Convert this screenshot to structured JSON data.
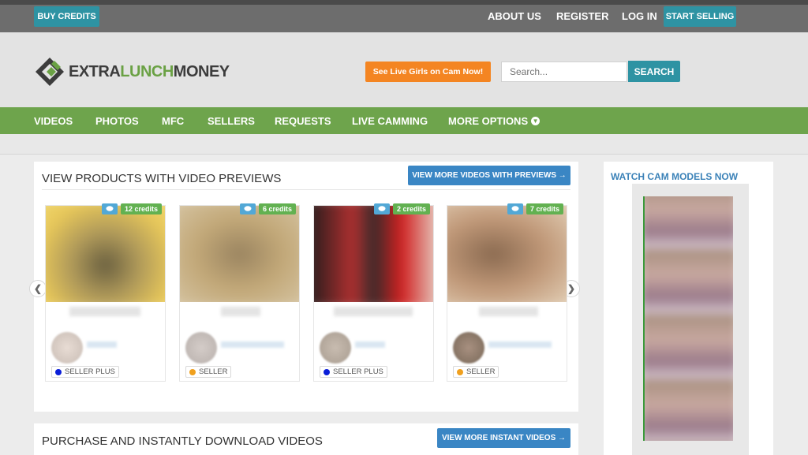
{
  "topbar": {
    "buy_credits": "BUY CREDITS",
    "links": [
      "ABOUT US",
      "REGISTER",
      "LOG IN"
    ],
    "start_selling": "START SELLING"
  },
  "header": {
    "logo_part1": "EXTRA",
    "logo_part2": "LUNCH",
    "logo_part3": "MONEY",
    "live_button": "See Live Girls on Cam Now!",
    "search_placeholder": "Search...",
    "search_button": "SEARCH"
  },
  "nav": {
    "items": [
      "VIDEOS",
      "PHOTOS",
      "MFC",
      "SELLERS",
      "REQUESTS",
      "LIVE CAMMING",
      "MORE OPTIONS"
    ]
  },
  "section1": {
    "title": "VIEW PRODUCTS WITH VIDEO PREVIEWS",
    "button": "VIEW MORE VIDEOS WITH PREVIEWS →",
    "products": [
      {
        "credits": "12 credits",
        "tier": "SELLER PLUS",
        "tier_color": "#0a1ed8"
      },
      {
        "credits": "6 credits",
        "tier": "SELLER",
        "tier_color": "#f0a01e"
      },
      {
        "credits": "2 credits",
        "tier": "SELLER PLUS",
        "tier_color": "#0a1ed8"
      },
      {
        "credits": "7 credits",
        "tier": "SELLER",
        "tier_color": "#f0a01e"
      }
    ]
  },
  "section2": {
    "title": "PURCHASE AND INSTANTLY DOWNLOAD VIDEOS",
    "button": "VIEW MORE INSTANT VIDEOS →"
  },
  "sidebar": {
    "title": "WATCH CAM MODELS NOW"
  },
  "colors": {
    "teal": "#2e93a3",
    "green_nav": "#6ea44c",
    "orange": "#f48522",
    "blue_button": "#3a86c4"
  }
}
